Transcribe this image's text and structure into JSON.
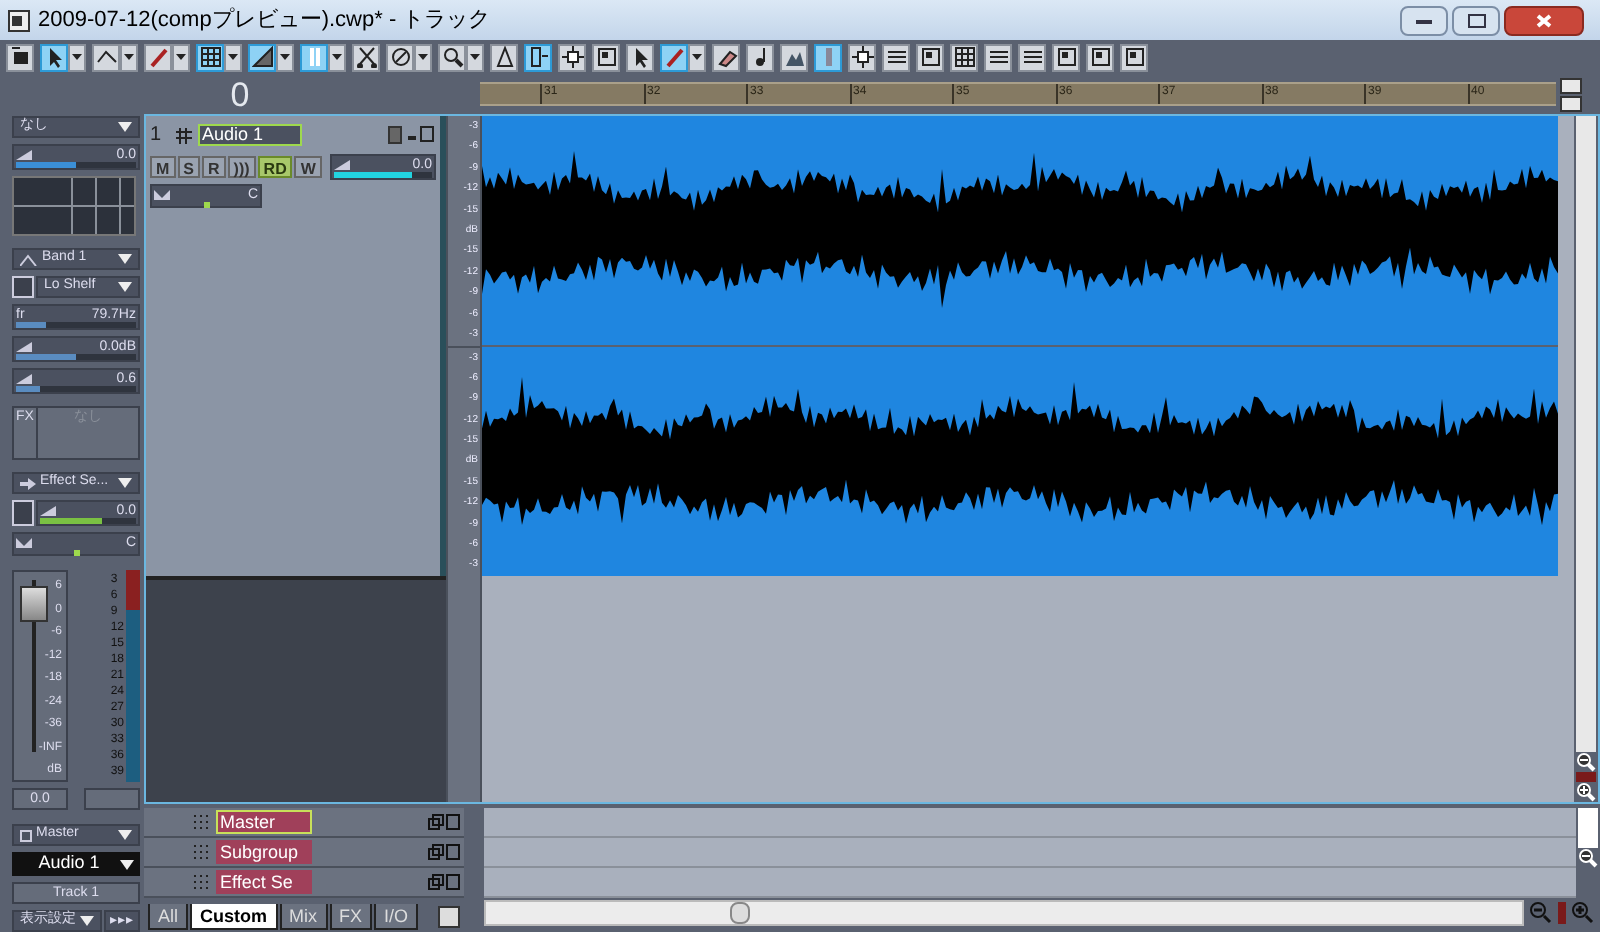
{
  "window": {
    "title": "2009-07-12(compプレビュー).cwp* - トラック"
  },
  "toolbar": [
    {
      "kind": "insert",
      "selected": false,
      "dropdown": false
    },
    {
      "kind": "pointer",
      "selected": true,
      "dropdown": true
    },
    {
      "kind": "curve",
      "selected": false,
      "dropdown": true
    },
    {
      "kind": "pencil",
      "selected": false,
      "dropdown": true
    },
    {
      "kind": "grid",
      "selected": true,
      "dropdown": true
    },
    {
      "kind": "snap",
      "selected": true,
      "dropdown": true
    },
    {
      "kind": "bars",
      "selected": true,
      "dropdown": true
    },
    {
      "kind": "scissors",
      "selected": false,
      "dropdown": false
    },
    {
      "kind": "slash",
      "selected": false,
      "dropdown": true
    },
    {
      "kind": "zoom",
      "selected": false,
      "dropdown": true
    },
    {
      "kind": "fan",
      "selected": false,
      "dropdown": false
    },
    {
      "kind": "split",
      "selected": true,
      "dropdown": false
    },
    {
      "kind": "cross",
      "selected": false,
      "dropdown": false
    },
    {
      "kind": "frame",
      "selected": false,
      "dropdown": false
    },
    {
      "kind": "pointer",
      "selected": false,
      "dropdown": false
    },
    {
      "kind": "pencil",
      "selected": true,
      "dropdown": true
    },
    {
      "kind": "eraser",
      "selected": false,
      "dropdown": false
    },
    {
      "kind": "note",
      "selected": false,
      "dropdown": false
    },
    {
      "kind": "mountain",
      "selected": false,
      "dropdown": false
    },
    {
      "kind": "meter",
      "selected": true,
      "dropdown": false
    },
    {
      "kind": "cross",
      "selected": false,
      "dropdown": false
    },
    {
      "kind": "lines",
      "selected": false,
      "dropdown": false
    },
    {
      "kind": "frame",
      "selected": false,
      "dropdown": false
    },
    {
      "kind": "grid",
      "selected": false,
      "dropdown": false
    },
    {
      "kind": "lines",
      "selected": false,
      "dropdown": false
    },
    {
      "kind": "lines",
      "selected": false,
      "dropdown": false
    },
    {
      "kind": "frame",
      "selected": false,
      "dropdown": false
    },
    {
      "kind": "frame",
      "selected": false,
      "dropdown": false
    },
    {
      "kind": "frame",
      "selected": false,
      "dropdown": false
    }
  ],
  "now_time": "0",
  "ruler": {
    "marks": [
      "31",
      "32",
      "33",
      "34",
      "35",
      "36",
      "37",
      "38",
      "39",
      "40"
    ]
  },
  "inspector": {
    "input": "なし",
    "volume": {
      "value": "0.0",
      "level": 0.5
    },
    "eq": {
      "band": "Band 1",
      "type": "Lo Shelf",
      "enabled": false,
      "params": [
        {
          "label": "fr",
          "value": "79.7Hz",
          "level": 0.25
        },
        {
          "value": "0.0dB",
          "level": 0.5
        },
        {
          "value": "0.6",
          "level": 0.2
        }
      ]
    },
    "fx": {
      "label": "FX",
      "value": "なし"
    },
    "send": {
      "name": "Effect Se...",
      "enabled": false,
      "value": "0.0",
      "level": 0.65
    },
    "pan": {
      "value": "C",
      "level": 0.5
    },
    "fader": {
      "level": 0.86,
      "scale": [
        "6",
        "0",
        "-6",
        "-12",
        "-18",
        "-24",
        "-36",
        "-INF",
        "dB"
      ],
      "value": "0.0"
    },
    "meter": {
      "scale": [
        "3",
        "6",
        "9",
        "12",
        "15",
        "18",
        "21",
        "24",
        "27",
        "30",
        "33",
        "36",
        "39"
      ]
    },
    "output": "Master",
    "track_select": "Audio 1",
    "track_label": "Track 1",
    "view_settings": "表示設定",
    "more": "▸▸▸"
  },
  "track": {
    "number": "1",
    "name": "Audio 1",
    "buttons": [
      {
        "label": "M",
        "selected": false
      },
      {
        "label": "S",
        "selected": false
      },
      {
        "label": "R",
        "selected": false
      },
      {
        "label": ")))",
        "selected": false
      },
      {
        "label": "RD",
        "selected": true
      },
      {
        "label": "W",
        "selected": false
      }
    ],
    "volume": {
      "value": "0.0",
      "level": 0.8
    },
    "pan": {
      "value": "C",
      "level": 0.5
    }
  },
  "clip": {
    "lanes": [
      {
        "scale": [
          "-3",
          "-6",
          "-9",
          "-12",
          "-15",
          "dB",
          "-15",
          "-12",
          "-9",
          "-6",
          "-3"
        ]
      },
      {
        "scale": [
          "-3",
          "-6",
          "-9",
          "-12",
          "-15",
          "dB",
          "-15",
          "-12",
          "-9",
          "-6",
          "-3"
        ]
      }
    ]
  },
  "buses": [
    {
      "name": "Master",
      "selected": true
    },
    {
      "name": "Subgroup",
      "selected": false
    },
    {
      "name": "Effect Se",
      "selected": false
    }
  ],
  "tabs": [
    {
      "label": "All",
      "selected": false
    },
    {
      "label": "Custom",
      "selected": true
    },
    {
      "label": "Mix",
      "selected": false
    },
    {
      "label": "FX",
      "selected": false
    },
    {
      "label": "I/O",
      "selected": false
    }
  ]
}
